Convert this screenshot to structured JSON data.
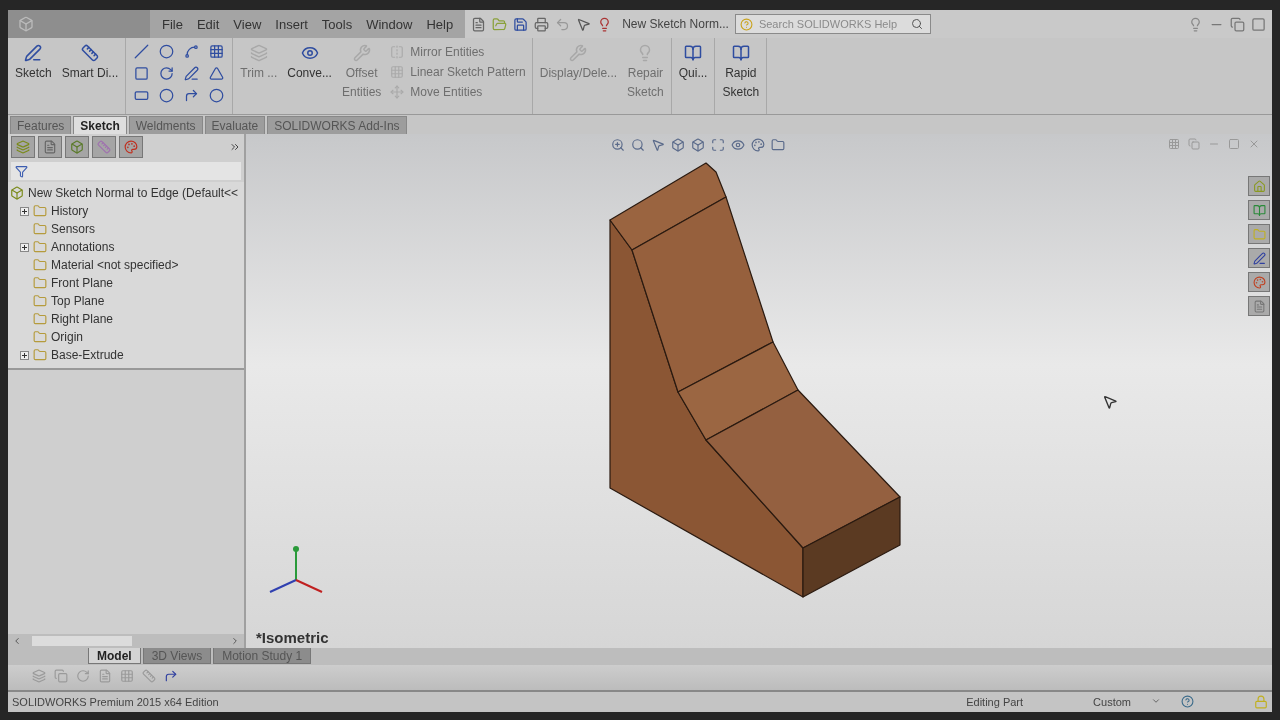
{
  "title_bar": {
    "menus": [
      "File",
      "Edit",
      "View",
      "Insert",
      "Tools",
      "Window",
      "Help"
    ],
    "document_title": "New Sketch Norm...",
    "search": {
      "placeholder": "Search SOLIDWORKS Help"
    }
  },
  "command_groups": [
    [
      {
        "kind": "large",
        "label": "Sketch",
        "disabled": false
      },
      {
        "kind": "large",
        "label": "Smart Di...",
        "disabled": false
      }
    ],
    [
      {
        "kind": "grid"
      }
    ],
    [
      {
        "kind": "large",
        "label": "Trim ...",
        "disabled": true
      },
      {
        "kind": "large",
        "label": "Conve...",
        "disabled": false
      },
      {
        "kind": "large",
        "label": "Offset\nEntities",
        "disabled": true
      },
      {
        "kind": "stack",
        "items": [
          {
            "label": "Mirror Entities",
            "disabled": true
          },
          {
            "label": "Linear Sketch Pattern",
            "disabled": true
          },
          {
            "label": "Move Entities",
            "disabled": true
          }
        ]
      }
    ],
    [
      {
        "kind": "large",
        "label": "Display/Dele...",
        "disabled": true
      },
      {
        "kind": "large",
        "label": "Repair\nSketch",
        "disabled": true
      }
    ],
    [
      {
        "kind": "large",
        "label": "Qui...",
        "disabled": false
      }
    ],
    [
      {
        "kind": "large",
        "label": "Rapid\nSketch",
        "disabled": false
      }
    ]
  ],
  "command_tabs": [
    {
      "label": "Features",
      "selected": false
    },
    {
      "label": "Sketch",
      "selected": true
    },
    {
      "label": "Weldments",
      "selected": false
    },
    {
      "label": "Evaluate",
      "selected": false
    },
    {
      "label": "SOLIDWORKS Add-Ins",
      "selected": false
    }
  ],
  "feature_tree": {
    "label": "New Sketch Normal to Edge  (Default<<",
    "children": [
      {
        "label": "History",
        "collapsed": true
      },
      {
        "label": "Sensors",
        "collapsed": false
      },
      {
        "label": "Annotations",
        "collapsed": true
      },
      {
        "label": "Material <not specified>",
        "collapsed": false
      },
      {
        "label": "Front Plane",
        "collapsed": false
      },
      {
        "label": "Top Plane",
        "collapsed": false
      },
      {
        "label": "Right Plane",
        "collapsed": false
      },
      {
        "label": "Origin",
        "collapsed": false
      },
      {
        "label": "Base-Extrude",
        "collapsed": true
      }
    ]
  },
  "viewport": {
    "view_name": "*Isometric"
  },
  "bottom_tabs": [
    {
      "label": "Model",
      "selected": true
    },
    {
      "label": "3D Views",
      "selected": false
    },
    {
      "label": "Motion Study 1",
      "selected": false
    }
  ],
  "status_bar": {
    "product": "SOLIDWORKS Premium 2015 x64 Edition",
    "mode": "Editing Part",
    "units": "Custom"
  }
}
